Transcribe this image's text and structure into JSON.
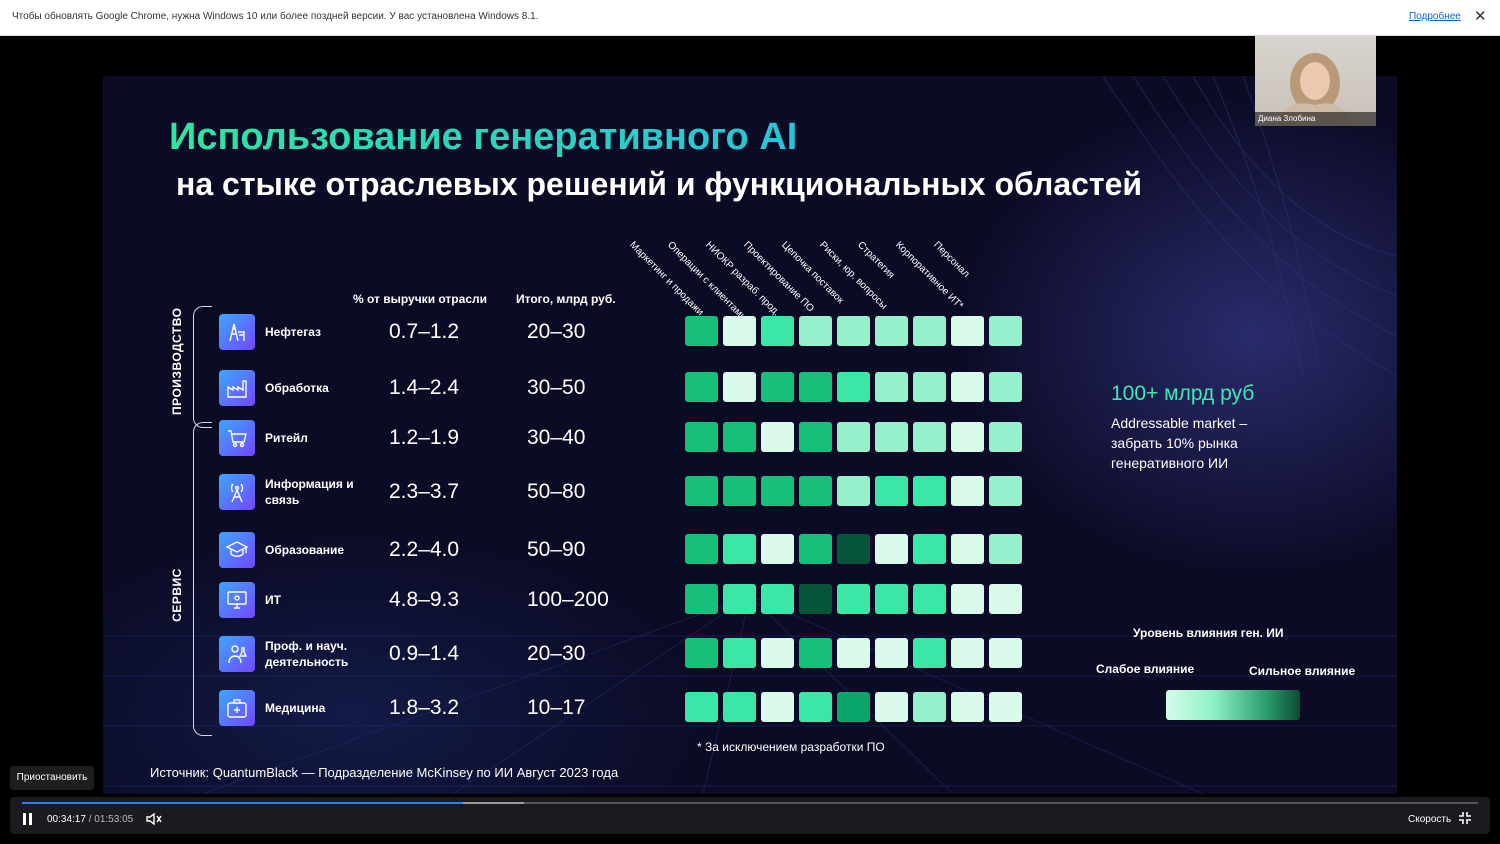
{
  "infobar": {
    "message": "Чтобы обновлять Google Chrome, нужна Windows 10 или более поздней версии. У вас установлена Windows 8.1.",
    "more_link": "Подробнее",
    "close_glyph": "✕"
  },
  "slide": {
    "title_line1": "Использование генеративного AI",
    "title_line2": "на стыке отраслевых решений и функциональных областей",
    "col_pct_header": "% от выручки отрасли",
    "col_total_header": "Итого, млрд руб.",
    "group_production": "ПРОИЗВОДСТВО",
    "group_service": "СЕРВИС",
    "function_labels": [
      "Маркетинг и продажи",
      "Операции с клиентами",
      "НИОКР разраб. прод.",
      "Проектирование ПО",
      "Цепочка поставок",
      "Риски, юр. вопросы",
      "Стратегия",
      "Корпоративное ИТ*",
      "Персонал"
    ],
    "footnote": "* За исключением разработки ПО",
    "source": "Источник: QuantumBlack — Подразделение McKinsey по ИИ Август 2023 года",
    "side_headline": "100+ млрд руб",
    "side_text": "Addressable market – забрать 10% рынка генеративного ИИ",
    "legend_title": "Уровень влияния ген. ИИ",
    "legend_weak": "Слабое влияние",
    "legend_strong": "Сильное влияние",
    "colors": {
      "c1": "#dafbec",
      "c2": "#96f0cb",
      "c3": "#3ce6a7",
      "c4": "#16c07a",
      "c5": "#0aa56a",
      "c6": "#06543a"
    },
    "industries": [
      {
        "icon": "oil-derrick-icon",
        "label": "Нефтегаз",
        "pct": "0.7–1.2",
        "total": "20–30",
        "levels": [
          4,
          1,
          3,
          2,
          2,
          2,
          2,
          1,
          2
        ]
      },
      {
        "icon": "factory-icon",
        "label": "Обработка",
        "pct": "1.4–2.4",
        "total": "30–50",
        "levels": [
          4,
          1,
          4,
          4,
          3,
          2,
          2,
          1,
          2
        ]
      },
      {
        "icon": "cart-icon",
        "label": "Ритейл",
        "pct": "1.2–1.9",
        "total": "30–40",
        "levels": [
          4,
          4,
          1,
          4,
          2,
          2,
          2,
          1,
          2
        ]
      },
      {
        "icon": "antenna-icon",
        "label": "Информация и связь",
        "pct": "2.3–3.7",
        "total": "50–80",
        "levels": [
          4,
          4,
          4,
          4,
          2,
          3,
          3,
          1,
          2
        ]
      },
      {
        "icon": "graduation-cap-icon",
        "label": "Образование",
        "pct": "2.2–4.0",
        "total": "50–90",
        "levels": [
          4,
          3,
          1,
          4,
          6,
          1,
          3,
          1,
          2
        ]
      },
      {
        "icon": "computer-icon",
        "label": "ИТ",
        "pct": "4.8–9.3",
        "total": "100–200",
        "levels": [
          4,
          3,
          3,
          6,
          3,
          3,
          3,
          1,
          1
        ]
      },
      {
        "icon": "scientist-icon",
        "label": "Проф. и науч. деятельность",
        "pct": "0.9–1.4",
        "total": "20–30",
        "levels": [
          4,
          3,
          1,
          4,
          1,
          1,
          3,
          1,
          1
        ]
      },
      {
        "icon": "medical-kit-icon",
        "label": "Медицина",
        "pct": "1.8–3.2",
        "total": "10–17",
        "levels": [
          3,
          3,
          1,
          3,
          5,
          1,
          2,
          1,
          1
        ]
      }
    ]
  },
  "webcam": {
    "name": "Диана Злобина"
  },
  "player": {
    "tooltip": "Приостановить",
    "current_time": "00:34:17",
    "duration": "01:53:05",
    "separator": "/",
    "speed_label": "Скорость",
    "progress_fraction": 0.303,
    "buffered_fraction": 0.345
  }
}
